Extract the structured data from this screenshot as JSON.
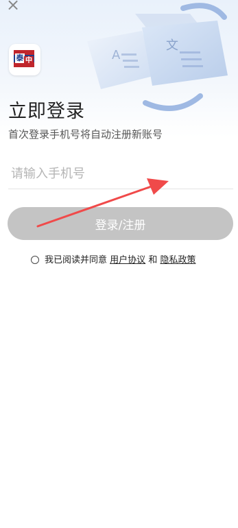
{
  "header": {
    "close_glyph": "×"
  },
  "logo": {
    "char_top": "泰",
    "char_bottom": "中"
  },
  "title": "立即登录",
  "subtitle": "首次登录手机号将自动注册新账号",
  "phone_input": {
    "placeholder": "请输入手机号",
    "value": ""
  },
  "login_button": {
    "label": "登录/注册"
  },
  "agreement": {
    "prefix": "我已阅读并同意",
    "user_agreement": "用户协议",
    "and": "和",
    "privacy_policy": "隐私政策",
    "checked": false
  },
  "colors": {
    "button_bg": "#c4c4c4",
    "arrow": "#f04a4a",
    "flag_red": "#c0262c",
    "flag_blue": "#1f3f8c"
  }
}
